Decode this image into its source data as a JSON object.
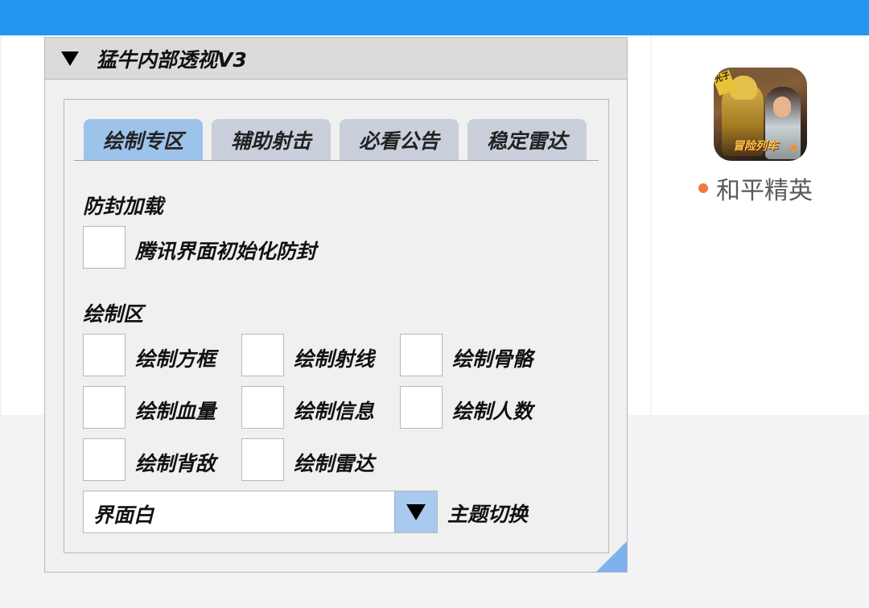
{
  "launcher": {
    "app_name": "和平精英",
    "icon_tag_left": "光子",
    "icon_tag_bottom": "冒险列车",
    "status_dot_color": "#ef7a3c"
  },
  "window": {
    "title": "猛牛内部透视V3",
    "collapsed": false,
    "accent_color": "#9ec3ea"
  },
  "tabs": [
    {
      "label": "绘制专区",
      "active": true
    },
    {
      "label": "辅助射击",
      "active": false
    },
    {
      "label": "必看公告",
      "active": false
    },
    {
      "label": "稳定雷达",
      "active": false
    }
  ],
  "section_protect": {
    "heading": "防封加载",
    "options": [
      {
        "label": "腾讯界面初始化防封",
        "checked": false
      }
    ]
  },
  "section_draw": {
    "heading": "绘制区",
    "options": [
      {
        "label": "绘制方框",
        "checked": false
      },
      {
        "label": "绘制射线",
        "checked": false
      },
      {
        "label": "绘制骨骼",
        "checked": false
      },
      {
        "label": "绘制血量",
        "checked": false
      },
      {
        "label": "绘制信息",
        "checked": false
      },
      {
        "label": "绘制人数",
        "checked": false
      },
      {
        "label": "绘制背敌",
        "checked": false
      },
      {
        "label": "绘制雷达",
        "checked": false
      }
    ]
  },
  "theme_combo": {
    "value": "界面白",
    "label": "主题切换"
  }
}
